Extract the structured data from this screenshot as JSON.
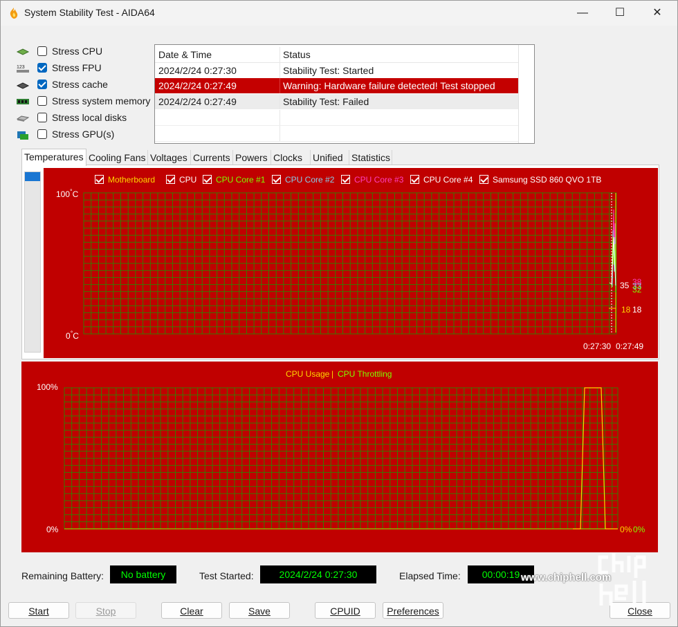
{
  "window": {
    "title": "System Stability Test - AIDA64",
    "controls": {
      "minimize": "—",
      "maximize": "☐",
      "close": "✕"
    }
  },
  "stress_options": [
    {
      "label": "Stress CPU",
      "checked": false,
      "icon": "cpu-chip-icon"
    },
    {
      "label": "Stress FPU",
      "checked": true,
      "icon": "fpu-123-icon"
    },
    {
      "label": "Stress cache",
      "checked": true,
      "icon": "cache-chip-icon"
    },
    {
      "label": "Stress system memory",
      "checked": false,
      "icon": "memory-module-icon"
    },
    {
      "label": "Stress local disks",
      "checked": false,
      "icon": "disk-drive-icon"
    },
    {
      "label": "Stress GPU(s)",
      "checked": false,
      "icon": "gpu-card-icon"
    }
  ],
  "log": {
    "headers": [
      "Date & Time",
      "Status"
    ],
    "rows": [
      {
        "datetime": "2024/2/24 0:27:30",
        "status": "Stability Test: Started",
        "style": "normal"
      },
      {
        "datetime": "2024/2/24 0:27:49",
        "status": "Warning: Hardware failure detected! Test stopped",
        "style": "error"
      },
      {
        "datetime": "2024/2/24 0:27:49",
        "status": "Stability Test: Failed",
        "style": "gray"
      }
    ]
  },
  "tabs": [
    {
      "label": "Temperatures",
      "active": true
    },
    {
      "label": "Cooling Fans",
      "active": false
    },
    {
      "label": "Voltages",
      "active": false
    },
    {
      "label": "Currents",
      "active": false
    },
    {
      "label": "Powers",
      "active": false
    },
    {
      "label": "Clocks",
      "active": false
    },
    {
      "label": "Unified",
      "active": false
    },
    {
      "label": "Statistics",
      "active": false
    }
  ],
  "colors": {
    "graph_bg": "#c00000",
    "grid": "#3a7a00",
    "motherboard": "#ffd700",
    "cpu": "#ffffff",
    "core1": "#7fff00",
    "core2": "#87ceeb",
    "core3": "#ff3fbf",
    "core4": "#ffffff",
    "ssd": "#ffffff",
    "usage": "#ffd700",
    "throttling": "#7fff00"
  },
  "temp_legend": [
    {
      "label": "Motherboard",
      "color": "#ffd700"
    },
    {
      "label": "CPU",
      "color": "#ffffff"
    },
    {
      "label": "CPU Core #1",
      "color": "#7fff00"
    },
    {
      "label": "CPU Core #2",
      "color": "#87ceeb"
    },
    {
      "label": "CPU Core #3",
      "color": "#ff3fbf"
    },
    {
      "label": "CPU Core #4",
      "color": "#ffffff"
    },
    {
      "label": "Samsung SSD 860 QVO 1TB",
      "color": "#ffffff"
    }
  ],
  "temp_axis": {
    "max": "100",
    "min": "0",
    "unit": "°C",
    "t_start": "0:27:30",
    "t_end": "0:27:49"
  },
  "temp_readouts": [
    {
      "value": "35",
      "color": "#ffffff"
    },
    {
      "value": "38",
      "color": "#ff3fbf"
    },
    {
      "value": "33",
      "color": "#87ceeb"
    },
    {
      "value": "32",
      "color": "#7fff00"
    },
    {
      "value": "18",
      "color": "#ffd700"
    },
    {
      "value": "18",
      "color": "#ffffff"
    }
  ],
  "usage_graph": {
    "title_usage": "CPU Usage",
    "separator": "|",
    "title_throttling": "CPU Throttling",
    "max_label": "100%",
    "min_label": "0%",
    "usage_value": "0%",
    "throttling_value": "0%"
  },
  "status": {
    "battery_label": "Remaining Battery:",
    "battery_value": "No battery",
    "started_label": "Test Started:",
    "started_value": "2024/2/24 0:27:30",
    "elapsed_label": "Elapsed Time:",
    "elapsed_value": "00:00:19"
  },
  "buttons": {
    "start": "Start",
    "stop": "Stop",
    "clear": "Clear",
    "save": "Save",
    "cpuid": "CPUID",
    "preferences": "Preferences",
    "close": "Close"
  },
  "watermark": {
    "text": "www.chiphell.com"
  }
}
